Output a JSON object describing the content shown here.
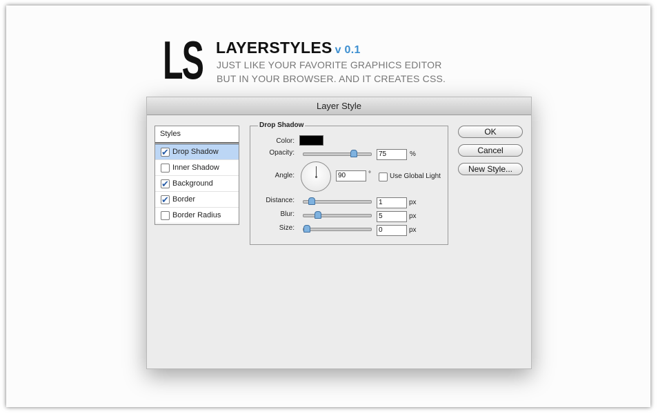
{
  "header": {
    "logo": "LS",
    "title": "LAYERSTYLES",
    "version": "v 0.1",
    "tagline_1": "JUST LIKE YOUR FAVORITE GRAPHICS EDITOR",
    "tagline_2": "BUT IN YOUR BROWSER. AND IT CREATES CSS."
  },
  "dialog": {
    "title": "Layer Style",
    "styles_header": "Styles",
    "styles": [
      {
        "label": "Drop Shadow",
        "checked": true,
        "selected": true
      },
      {
        "label": "Inner Shadow",
        "checked": false,
        "selected": false
      },
      {
        "label": "Background",
        "checked": true,
        "selected": false
      },
      {
        "label": "Border",
        "checked": true,
        "selected": false
      },
      {
        "label": "Border Radius",
        "checked": false,
        "selected": false
      }
    ],
    "drop_shadow": {
      "group_title": "Drop Shadow",
      "color_label": "Color:",
      "color": "#000000",
      "opacity_label": "Opacity:",
      "opacity_value": "75",
      "opacity_unit": "%",
      "opacity_slider_fraction": 0.75,
      "angle_label": "Angle:",
      "angle_value": "90",
      "angle_unit": "°",
      "global_light_label": "Use Global Light",
      "global_light_checked": false,
      "distance_label": "Distance:",
      "distance_value": "1",
      "distance_unit": "px",
      "distance_slider_fraction": 0.08,
      "blur_label": "Blur:",
      "blur_value": "5",
      "blur_unit": "px",
      "blur_slider_fraction": 0.18,
      "size_label": "Size:",
      "size_value": "0",
      "size_unit": "px",
      "size_slider_fraction": 0.0
    },
    "buttons": {
      "ok": "OK",
      "cancel": "Cancel",
      "new_style": "New Style..."
    }
  },
  "colors": {
    "accent": "#3d8fd0",
    "selection": "#bcd6f5"
  }
}
